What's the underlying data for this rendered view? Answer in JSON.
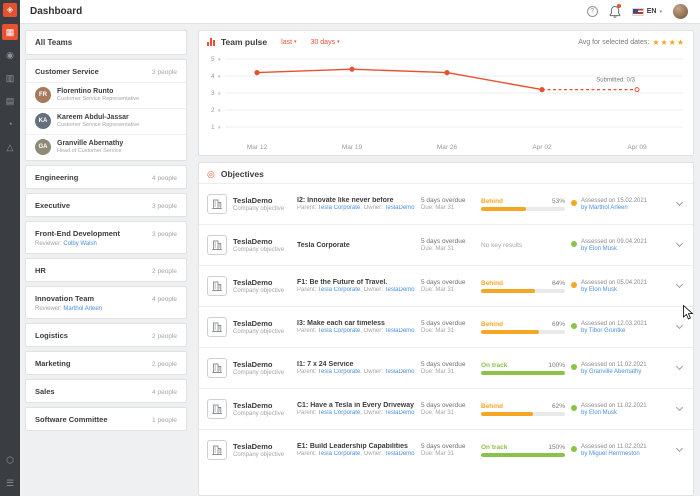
{
  "colors": {
    "accent": "#e8512f",
    "behind": "#f5a623",
    "on_track": "#8bc34a",
    "link": "#4a90e2"
  },
  "topbar": {
    "title": "Dashboard",
    "help_icon": "?",
    "language": "EN"
  },
  "rail": {
    "logo": {
      "name": "app-logo",
      "glyph": "◈"
    },
    "items": [
      {
        "name": "dashboard",
        "glyph": "▦",
        "active": true
      },
      {
        "name": "okrs",
        "glyph": "◉",
        "active": false
      },
      {
        "name": "teams",
        "glyph": "▥",
        "active": false
      },
      {
        "name": "reports",
        "glyph": "▤",
        "active": false
      },
      {
        "name": "insights",
        "glyph": "◔",
        "active": false
      },
      {
        "name": "alignment",
        "glyph": "△",
        "active": false
      }
    ],
    "bottom_items": [
      {
        "name": "integrations",
        "glyph": "⬡"
      },
      {
        "name": "menu",
        "glyph": "☰"
      }
    ]
  },
  "sidebar": {
    "header": "All Teams",
    "teams": [
      {
        "name": "Customer Service",
        "count": "3 people",
        "members": [
          {
            "name": "Florentino Runto",
            "role": "Customer Service Representative"
          },
          {
            "name": "Kareem Abdul-Jassar",
            "role": "Customer Service Representative"
          },
          {
            "name": "Granville Abernathy",
            "role": "Head of Customer Service"
          }
        ]
      },
      {
        "name": "Engineering",
        "count": "4 people"
      },
      {
        "name": "Executive",
        "count": "3 people"
      },
      {
        "name": "Front-End Development",
        "count": "3 people",
        "reviewer_label": "Reviewer:",
        "reviewer": "Colby Walsh"
      },
      {
        "name": "HR",
        "count": "2 people"
      },
      {
        "name": "Innovation Team",
        "count": "4 people",
        "reviewer_label": "Reviewer:",
        "reviewer": "Marthol Arleen"
      },
      {
        "name": "Logistics",
        "count": "2 people"
      },
      {
        "name": "Marketing",
        "count": "2 people"
      },
      {
        "name": "Sales",
        "count": "4 people"
      },
      {
        "name": "Software Committee",
        "count": "1 people"
      }
    ]
  },
  "pulse": {
    "title": "Team pulse",
    "range_filter": "last",
    "period_filter": "30 days",
    "avg_label": "Avg for selected dates:",
    "stars": "★★★★"
  },
  "chart_data": {
    "type": "line",
    "title": "Team pulse",
    "x": [
      "Mar 12",
      "Mar 19",
      "Mar 26",
      "Apr 02",
      "Apr 09"
    ],
    "values": [
      4.2,
      4.4,
      4.2,
      3.2,
      3.2
    ],
    "dashed_from_index": 3,
    "yticks": [
      5,
      4,
      3,
      2,
      1
    ],
    "ylim": [
      1,
      5
    ],
    "y_unit": "stars",
    "grid": true,
    "line_color": "#e8512f",
    "annotation": {
      "text": "Submitted: 0/3",
      "at_index": 4
    }
  },
  "objectives": {
    "title": "Objectives",
    "labels": {
      "parent": "Parent:",
      "owner": ",  Owner:"
    },
    "rows": [
      {
        "company": "TeslaDemo",
        "category": "Company objective",
        "title": "I2: Innovate like never before",
        "parent": "Tesla Corporate",
        "owner": "TeslaDemo",
        "overdue": "5 days overdue",
        "due": "Due: Mar 31",
        "status": "Behind",
        "progress_pct": 53,
        "progress_label": "53%",
        "assessed": "Assessed on 15.02.2021",
        "assessed_by": "by Marthol Arleen",
        "dot": "orange"
      },
      {
        "company": "TeslaDemo",
        "category": "Company objective",
        "title": "Tesla Corporate",
        "overdue": "5 days overdue",
        "due": "Due: Mar 31",
        "no_results": "No key results",
        "assessed": "Assessed on 09.04.2021",
        "assessed_by": "by Elon Musk",
        "dot": "green"
      },
      {
        "company": "TeslaDemo",
        "category": "Company objective",
        "title": "F1: Be the Future of Travel.",
        "parent": "Tesla Corporate",
        "owner": "TeslaDemo",
        "overdue": "5 days overdue",
        "due": "Due: Mar 31",
        "status": "Behind",
        "progress_pct": 64,
        "progress_label": "64%",
        "assessed": "Assessed on 05.04.2021",
        "assessed_by": "by Elon Musk",
        "dot": "orange"
      },
      {
        "company": "TeslaDemo",
        "category": "Company objective",
        "title": "I3: Make each car timeless",
        "parent": "Tesla Corporate",
        "owner": "TeslaDemo",
        "overdue": "5 days overdue",
        "due": "Due: Mar 31",
        "status": "Behind",
        "progress_pct": 69,
        "progress_label": "69%",
        "assessed": "Assessed on 12.03.2021",
        "assessed_by": "by Tibor Gruntke",
        "dot": "green"
      },
      {
        "company": "TeslaDemo",
        "category": "Company objective",
        "title": "I1: 7 x 24 Service",
        "parent": "Tesla Corporate",
        "owner": "TeslaDemo",
        "overdue": "5 days overdue",
        "due": "Due: Mar 31",
        "status": "On track",
        "progress_pct": 100,
        "progress_label": "100%",
        "assessed": "Assessed on 11.02.2021",
        "assessed_by": "by Granville Abernathy",
        "dot": "green"
      },
      {
        "company": "TeslaDemo",
        "category": "Company objective",
        "title": "C1: Have a Tesla in Every Driveway",
        "parent": "Tesla Corporate",
        "owner": "TeslaDemo",
        "overdue": "5 days overdue",
        "due": "Due: Mar 31",
        "status": "Behind",
        "progress_pct": 62,
        "progress_label": "62%",
        "assessed": "Assessed on 11.02.2021",
        "assessed_by": "by Elon Musk",
        "dot": "green"
      },
      {
        "company": "TeslaDemo",
        "category": "Company objective",
        "title": "E1: Build Leadership Capabilities",
        "parent": "Tesla Corporate",
        "owner": "TeslaDemo",
        "overdue": "5 days overdue",
        "due": "Due: Mar 31",
        "status": "On track",
        "progress_pct": 150,
        "progress_label": "150%",
        "assessed": "Assessed on 11.02.2021",
        "assessed_by": "by Miguel Herrmeston",
        "dot": "green"
      }
    ]
  }
}
